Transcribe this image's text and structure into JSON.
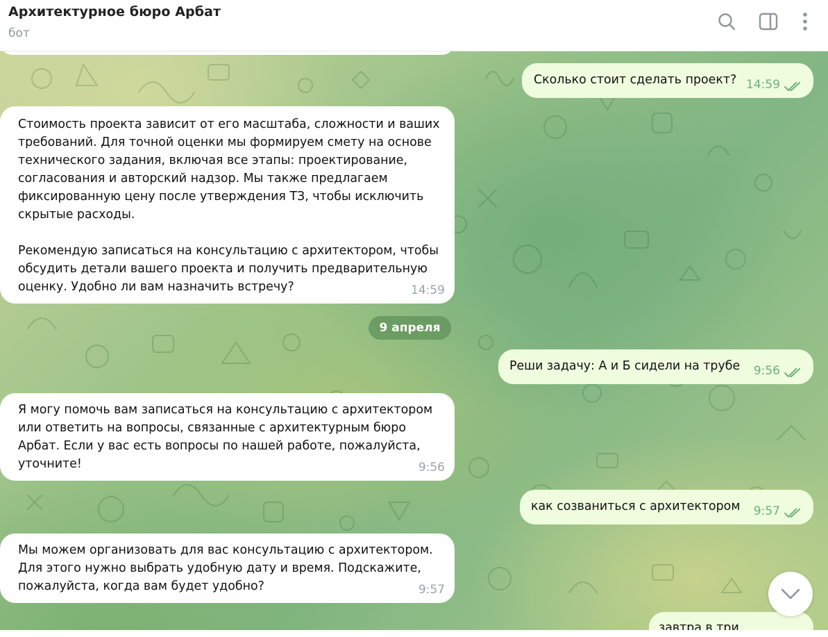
{
  "header": {
    "title": "Архитектурное бюро Арбат",
    "subtitle": "бот",
    "icons": [
      "search-icon",
      "sidebar-toggle-icon",
      "more-vertical-icon"
    ]
  },
  "messages": [
    {
      "text": "Сколько стоит сделать проект?",
      "time": "14:59",
      "direction": "out",
      "status": "read"
    },
    {
      "text": "Стоимость проекта зависит от его масштаба, сложности и ваших\nтребований. Для точной оценки мы формируем смету на основе\nтехнического задания, включая все этапы: проектирование,\nсогласования и авторский надзор. Мы также предлагаем\nфиксированную цену после утверждения ТЗ, чтобы исключить\nскрытые расходы.\n\nРекомендую записаться на консультацию с архитектором, чтобы\nобсудить детали вашего проекта и получить предварительную\nоценку. Удобно ли вам назначить встречу?",
      "time": "14:59",
      "direction": "in"
    },
    {
      "text": "Реши задачу: А и Б сидели на трубе",
      "time": "9:56",
      "direction": "out",
      "status": "read"
    },
    {
      "text": "Я могу помочь вам записаться на консультацию с архитектором\nили ответить на вопросы, связанные с архитектурным бюро\nАрбат. Если у вас есть вопросы по нашей работе, пожалуйста,\nуточните!",
      "time": "9:56",
      "direction": "in"
    },
    {
      "text": "как созваниться с архитектором",
      "time": "9:57",
      "direction": "out",
      "status": "read"
    },
    {
      "text": "Мы можем организовать для вас консультацию с архитектором.\nДля этого нужно выбрать удобную дату и время. Подскажите,\nпожалуйста, когда вам будет удобно?",
      "time": "9:57",
      "direction": "in"
    },
    {
      "text": "завтра в три",
      "direction": "out"
    }
  ],
  "date_separator": "9 апреля",
  "scroll_button_icon": "chevron-down-icon",
  "colors": {
    "incoming_bubble": "#ffffff",
    "outgoing_bubble": "#effdde",
    "outgoing_time": "#6bb37a",
    "incoming_time": "#9aa3a9",
    "date_pill": "#5f915a"
  }
}
